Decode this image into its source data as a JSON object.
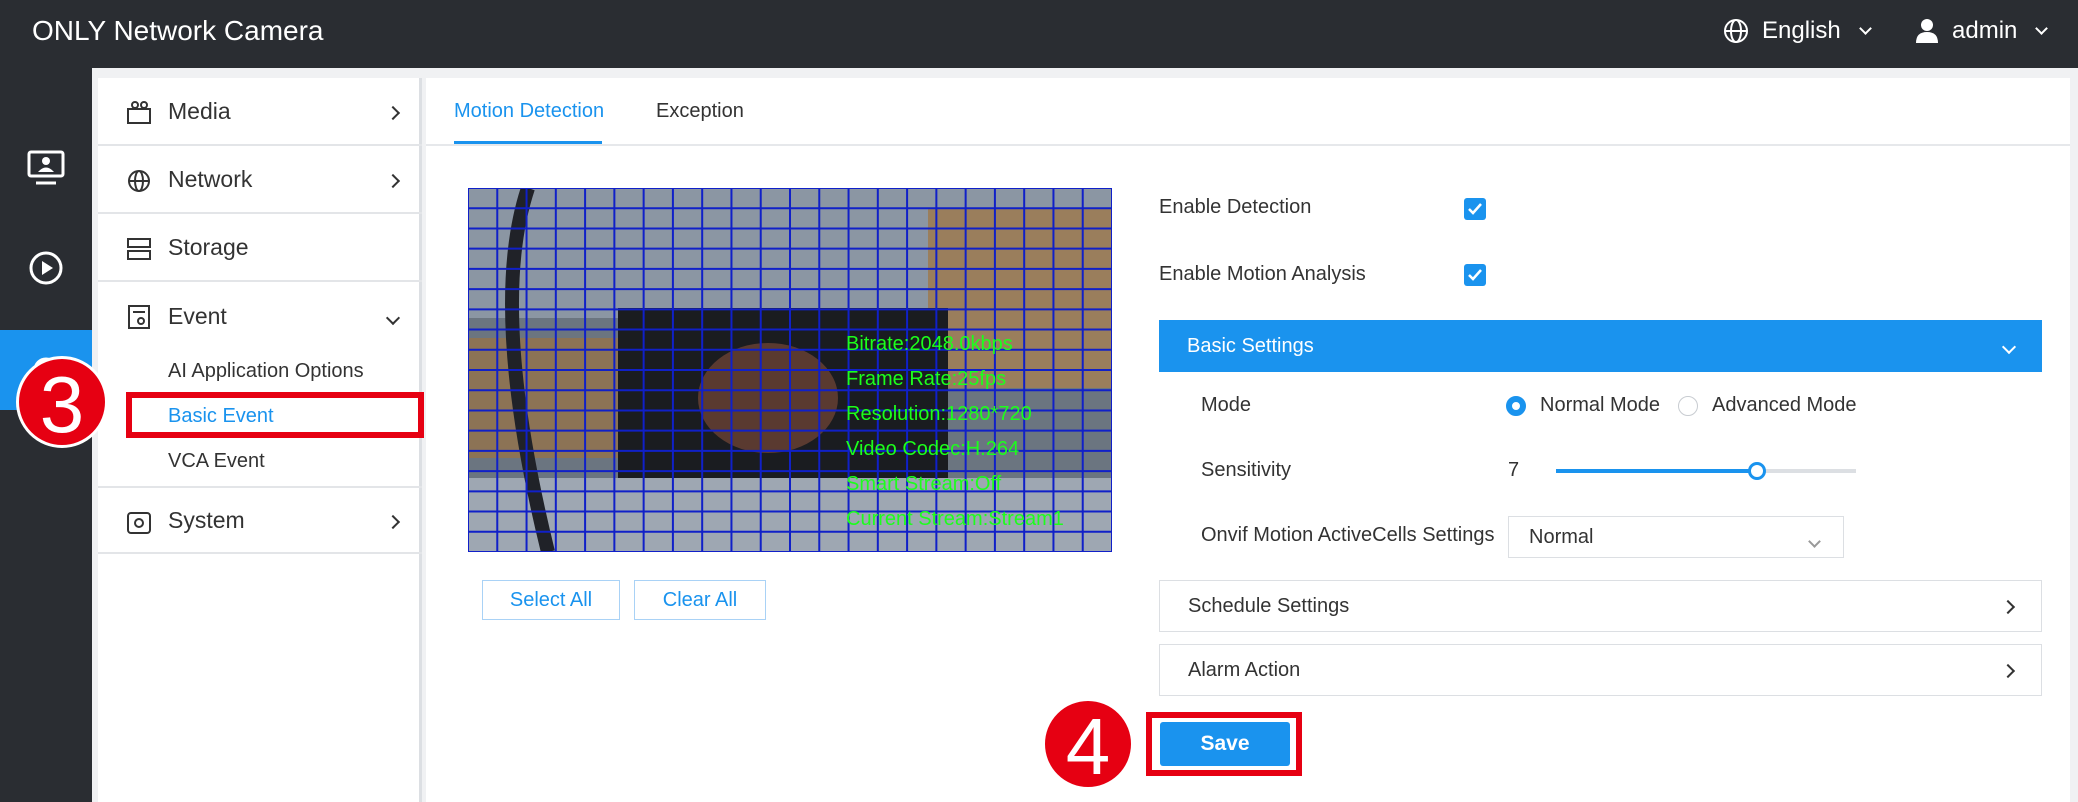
{
  "header": {
    "brand": "ONLY Network Camera",
    "language": "English",
    "user": "admin"
  },
  "rail": {
    "items": [
      "monitor-icon",
      "playback-icon",
      "settings-icon"
    ]
  },
  "menu": {
    "items": [
      {
        "label": "Media",
        "icon": "media-icon"
      },
      {
        "label": "Network",
        "icon": "globe-icon"
      },
      {
        "label": "Storage",
        "icon": "storage-icon"
      },
      {
        "label": "Event",
        "icon": "event-icon"
      },
      {
        "label": "System",
        "icon": "system-icon"
      }
    ],
    "event_sub": [
      "AI Application Options",
      "Basic Event",
      "VCA Event"
    ]
  },
  "tabs": [
    "Motion Detection",
    "Exception"
  ],
  "video": {
    "overlay": [
      "Bitrate:2048.0kbps",
      "Frame Rate:25fps",
      "Resolution:1280*720",
      "Video Codec:H.264",
      "Smart Stream:Off",
      "Current Stream:Stream1"
    ]
  },
  "buttons": {
    "select_all": "Select All",
    "clear_all": "Clear All",
    "save": "Save"
  },
  "settings": {
    "enable_detection": {
      "label": "Enable Detection",
      "checked": true
    },
    "enable_motion_analysis": {
      "label": "Enable Motion Analysis",
      "checked": true
    },
    "basic_settings": "Basic Settings",
    "mode_label": "Mode",
    "mode_options": [
      "Normal Mode",
      "Advanced Mode"
    ],
    "mode_selected": "Normal Mode",
    "sensitivity_label": "Sensitivity",
    "sensitivity_value": "7",
    "sensitivity_fraction": 0.67,
    "onvif_label": "Onvif Motion ActiveCells Settings",
    "onvif_value": "Normal",
    "schedule": "Schedule Settings",
    "alarm": "Alarm Action"
  },
  "annotations": {
    "step3": "3",
    "step4": "4"
  },
  "colors": {
    "accent": "#1a93ee",
    "dark": "#2a2d32",
    "annotation": "#e60012",
    "overlay_text": "#1cff1c",
    "grid": "#1020c8"
  }
}
